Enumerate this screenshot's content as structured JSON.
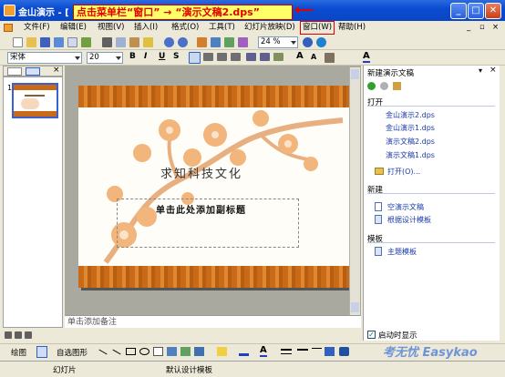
{
  "window": {
    "title": "金山演示 - [",
    "callout": "点击菜单栏“窗口” → “演示文稿2.dps”"
  },
  "menu": {
    "items": [
      "文件(F)",
      "编辑(E)",
      "视图(V)",
      "插入(I)",
      "格式(O)",
      "工具(T)",
      "幻灯片放映(D)",
      "窗口(W)",
      "帮助(H)"
    ]
  },
  "format_toolbar": {
    "font": "宋体",
    "size": "20",
    "zoom": "24 %",
    "bold": "B",
    "italic": "I",
    "underline": "U",
    "shadow": "S",
    "grow": "A",
    "shrink": "A",
    "fontcolor": "A"
  },
  "slide": {
    "title": "求知科技文化",
    "subtitle_placeholder": "单击此处添加副标题",
    "number": "1"
  },
  "notes": {
    "placeholder": "单击添加备注"
  },
  "taskpane": {
    "title": "新建演示文稿",
    "open_section": "打开",
    "recent": [
      "金山演示2.dps",
      "金山演示1.dps",
      "演示文稿2.dps",
      "演示文稿1.dps"
    ],
    "open_more": "打开(O)...",
    "new_section": "新建",
    "new_blank": "空演示文稿",
    "new_template": "根据设计模板",
    "template_section": "模板",
    "template_link": "主题模板",
    "startup_checkbox": "启动时显示",
    "startup_checked": true
  },
  "drawbar": {
    "draw": "绘图",
    "autoshapes": "自选图形"
  },
  "status": {
    "slides": "幻灯片",
    "design": "默认设计模板"
  },
  "watermark": "考无忧 Easykao",
  "colors": {
    "accent_red": "#E00000",
    "callout_bg": "#FFFF66",
    "titlebar": "#0A4BD0",
    "band": "#C86A18"
  }
}
